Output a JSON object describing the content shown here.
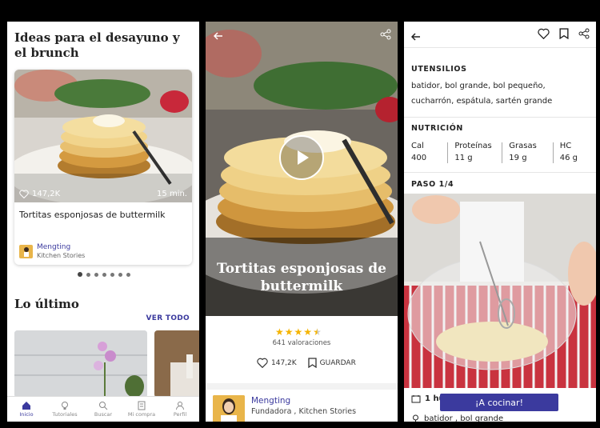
{
  "home": {
    "section_title": "Ideas para el desayuno y el brunch",
    "card": {
      "likes": "147,2K",
      "time": "15 min.",
      "recipe_name": "Tortitas esponjosas de buttermilk",
      "author_name": "Mengting",
      "author_sub": "Kitchen Stories"
    },
    "latest_title": "Lo último",
    "see_all": "VER TODO",
    "tabs": [
      {
        "label": "Inicio",
        "icon": "home-icon"
      },
      {
        "label": "Tutoriales",
        "icon": "lightbulb-icon"
      },
      {
        "label": "Buscar",
        "icon": "search-icon"
      },
      {
        "label": "Mi compra",
        "icon": "list-icon"
      },
      {
        "label": "Perfil",
        "icon": "person-icon"
      }
    ]
  },
  "detail": {
    "title": "Tortitas esponjosas de buttermilk",
    "rating": 4.5,
    "ratings_count": "641 valoraciones",
    "likes": "147,2K",
    "save": "GUARDAR",
    "author_name": "Mengting",
    "author_role": "Fundadora , Kitchen Stories"
  },
  "steps": {
    "utensils_title": "UTENSILIOS",
    "utensils_text": "batidor, bol grande, bol pequeño, cucharrón, espátula, sartén grande",
    "nutrition_title": "NUTRICIÓN",
    "nutrition": [
      {
        "label": "Cal",
        "value": "400"
      },
      {
        "label": "Proteínas",
        "value": "11 g"
      },
      {
        "label": "Grasas",
        "value": "19 g"
      },
      {
        "label": "HC",
        "value": "46 g"
      }
    ],
    "step_title": "PASO 1/4",
    "time_text": "1 hu",
    "tools_text": "batidor , bol grande",
    "cook_button": "¡A cocinar!"
  },
  "colors": {
    "accent": "#3b3a9e",
    "star": "#f5b400"
  }
}
